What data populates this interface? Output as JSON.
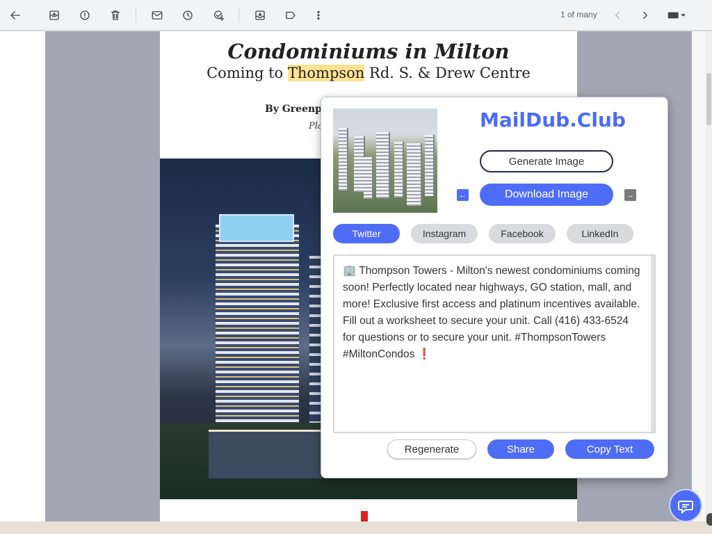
{
  "toolbar": {
    "icons": [
      "back-arrow-icon",
      "archive-icon",
      "report-spam-icon",
      "delete-icon",
      "mark-unread-icon",
      "snooze-icon",
      "add-task-icon",
      "move-to-icon",
      "label-icon",
      "more-icon",
      "chevron-left-icon",
      "chevron-right-icon",
      "keyboard-icon"
    ],
    "pager": "1 of many"
  },
  "email": {
    "title": "Condominiums in Milton",
    "subtitle_before": "Coming to ",
    "subtitle_highlight": "Thompson",
    "subtitle_after": " Rd. S. & Drew Centre",
    "byline": "By Greenp",
    "plan": "Pla"
  },
  "popup": {
    "brand": "MailDub.Club",
    "generate_label": "Generate Image",
    "download_label": "Download Image",
    "prev_glyph": "←",
    "next_glyph": "→",
    "tabs": [
      {
        "label": "Twitter",
        "active": true
      },
      {
        "label": "Instagram",
        "active": false
      },
      {
        "label": "Facebook",
        "active": false
      },
      {
        "label": "LinkedIn",
        "active": false
      }
    ],
    "post_text": "🏢 Thompson Towers - Milton's newest condominiums coming soon! Perfectly located near highways, GO station, mall, and more! Exclusive first access and platinum incentives available. Fill out a worksheet to secure your unit. Call (416) 433-6524 for questions or to secure your unit. #ThompsonTowers #MiltonCondos ❗",
    "regenerate_label": "Regenerate",
    "share_label": "Share",
    "copy_label": "Copy Text"
  },
  "colors": {
    "accent": "#4f6cf6",
    "brand": "#4a6cf7",
    "highlight": "#fde293"
  }
}
